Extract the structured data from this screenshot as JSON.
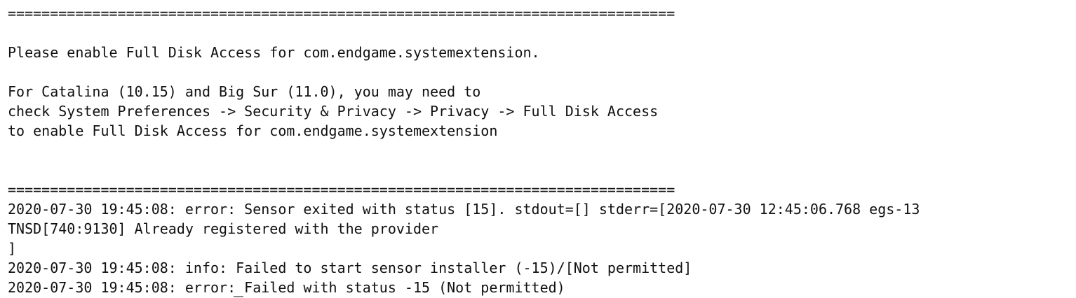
{
  "terminal": {
    "lines": [
      "===============================================================================",
      "Please enable Full Disk Access for com.endgame.systemextension.",
      "For Catalina (10.15) and Big Sur (11.0), you may need to",
      "check System Preferences -> Security & Privacy -> Privacy -> Full Disk Access",
      "to enable Full Disk Access for com.endgame.systemextension",
      "===============================================================================",
      "2020-07-30 19:45:08: error: Sensor exited with status [15]. stdout=[] stderr=[2020-07-30 12:45:06.768 egs-13",
      "TNSD[740:9130] Already registered with the provider",
      "]",
      "2020-07-30 19:45:08: info: Failed to start sensor installer (-15)/[Not permitted]",
      "2020-07-30 19:45:08: error: Failed with status -15 (Not permitted)"
    ]
  }
}
